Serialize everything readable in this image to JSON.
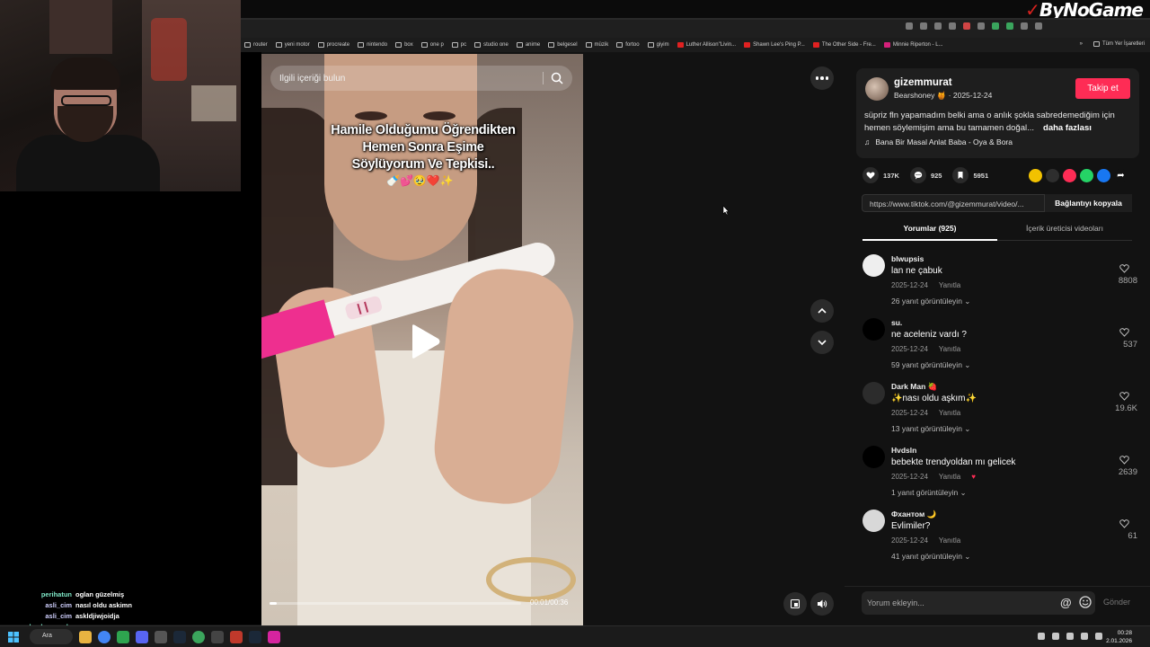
{
  "brand": {
    "mark": "✓",
    "name": "ByNoGame"
  },
  "bookmarks": [
    "router",
    "yeni motor",
    "procreate",
    "nintendo",
    "box",
    "one p",
    "pc",
    "studio one",
    "anime",
    "belgesel",
    "müzik",
    "fortoo",
    "giyim",
    "Luther Allison\"Livin...",
    "Shawn Lee's Ping P...",
    "The Other Side - Fre...",
    "Minnie Riperton - L..."
  ],
  "bookmarks_right": {
    "more": "»",
    "all": "Tüm Yer İşaretleri"
  },
  "chat": [
    {
      "user": "perihatun",
      "msg": "oglan güzelmiş"
    },
    {
      "user": "asli_cim",
      "msg": "nasıl oldu askimn"
    },
    {
      "user": "asli_cim",
      "msg": "askldjiwjoidja"
    },
    {
      "user": "selambenseyda",
      "msg": ""
    }
  ],
  "search": {
    "placeholder": "İlgili içeriği bulun"
  },
  "caption": {
    "line1": "Hamile Olduğumu Öğrendikten",
    "line2": "Hemen Sonra Eşime",
    "line3": "Söylüyorum Ve Tepkisi..",
    "emoji": "🍼💕🥹❤️✨"
  },
  "player": {
    "time": "00:01/00:36",
    "progress": 0.03
  },
  "post": {
    "author": "gizemmurat",
    "sub": "Bearshoney 🍯 · 2025-12-24",
    "follow": "Takip et",
    "description": "süpriz fln yapamadım belki ama o anlık şokla sabredemediğim için hemen söylemişim ama bu tamamen doğal...",
    "more": "daha fazlası",
    "music": "Bana Bir Masal Anlat Baba - Oya & Bora",
    "likes": "137K",
    "comments": "925",
    "saves": "5951",
    "link": "https://www.tiktok.com/@gizemmurat/video/...",
    "copy": "Bağlantıyı kopyala"
  },
  "tabs": {
    "comments": "Yorumlar (925)",
    "creator": "İçerik üreticisi videoları"
  },
  "comments": [
    {
      "user": "blwupsis",
      "text": "lan ne çabuk",
      "date": "2025-12-24",
      "reply": "Yanıtla",
      "replies": "26 yanıt görüntüleyin ⌄",
      "likes": "8808"
    },
    {
      "user": "su.",
      "text": "ne aceleniz vardı ?",
      "date": "2025-12-24",
      "reply": "Yanıtla",
      "replies": "59 yanıt görüntüleyin ⌄",
      "likes": "537"
    },
    {
      "user": "Dark Man 🍓",
      "text": "✨nası oldu aşkım✨",
      "date": "2025-12-24",
      "reply": "Yanıtla",
      "replies": "13 yanıt görüntüleyin ⌄",
      "likes": "19.6K"
    },
    {
      "user": "Hvdsln",
      "text": "bebekte trendyoldan mı gelicek",
      "date": "2025-12-24",
      "reply": "Yanıtla",
      "replies": "1 yanıt görüntüleyin ⌄",
      "likes": "2639"
    },
    {
      "user": "Фхантом 🌙",
      "text": "Evlimiler?",
      "date": "2025-12-24",
      "reply": "Yanıtla",
      "replies": "41 yanıt görüntüleyin ⌄",
      "likes": "61"
    }
  ],
  "comment_box": {
    "placeholder": "Yorum ekleyin...",
    "at": "@",
    "send": "Gönder"
  },
  "taskbar": {
    "search": "Ara",
    "time": "00:28",
    "date": "2.01.2026"
  },
  "colors": {
    "accent": "#fe2c55",
    "background": "#121212",
    "panel": "#1e1e1e"
  }
}
